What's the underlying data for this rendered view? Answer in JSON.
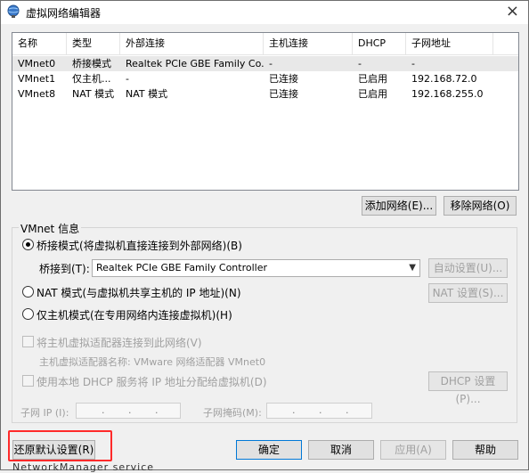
{
  "window": {
    "title": "虚拟网络编辑器",
    "close": "×"
  },
  "table": {
    "headers": [
      "名称",
      "类型",
      "外部连接",
      "主机连接",
      "DHCP",
      "子网地址"
    ],
    "rows": [
      [
        "VMnet0",
        "桥接模式",
        "Realtek PCIe GBE Family Co...",
        "-",
        "-",
        "-"
      ],
      [
        "VMnet1",
        "仅主机...",
        "-",
        "已连接",
        "已启用",
        "192.168.72.0"
      ],
      [
        "VMnet8",
        "NAT 模式",
        "NAT 模式",
        "已连接",
        "已启用",
        "192.168.255.0"
      ]
    ],
    "selected_row": 0
  },
  "buttons": {
    "add_network": "添加网络(E)...",
    "remove_network": "移除网络(O)",
    "auto_settings": "自动设置(U)...",
    "nat_settings": "NAT 设置(S)...",
    "dhcp_settings": "DHCP 设置(P)...",
    "restore_defaults": "还原默认设置(R)",
    "ok": "确定",
    "cancel": "取消",
    "apply": "应用(A)",
    "help": "帮助"
  },
  "vmnet_info": {
    "group_label": "VMnet 信息",
    "bridge_mode_label": "桥接模式(将虚拟机直接连接到外部网络)(B)",
    "bridge_to_label": "桥接到(T):",
    "bridge_to_value": "Realtek PCIe GBE Family Controller",
    "nat_mode_label": "NAT 模式(与虚拟机共享主机的 IP 地址)(N)",
    "host_only_label": "仅主机模式(在专用网络内连接虚拟机)(H)",
    "selected_mode": "bridge",
    "connect_adapter_label": "将主机虚拟适配器连接到此网络(V)",
    "adapter_name_label": "主机虚拟适配器名称: VMware 网络适配器 VMnet0",
    "use_dhcp_label": "使用本地 DHCP 服务将 IP 地址分配给虚拟机(D)",
    "subnet_ip_label": "子网 IP (I):",
    "subnet_mask_label": "子网掩码(M):"
  },
  "ip_dot": ".",
  "background_text": "NetworkManager service"
}
